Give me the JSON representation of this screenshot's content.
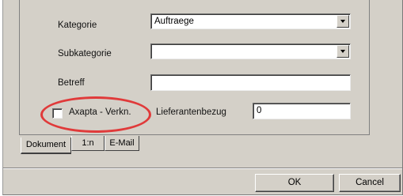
{
  "form": {
    "kategorie": {
      "label": "Kategorie",
      "value": "Auftraege"
    },
    "subkategorie": {
      "label": "Subkategorie",
      "value": ""
    },
    "betreff": {
      "label": "Betreff",
      "value": ""
    },
    "axapta_checkbox": {
      "label": "Axapta - Verkn.",
      "checked": false
    },
    "lieferantenbezug": {
      "label": "Lieferantenbezug",
      "value": "0"
    }
  },
  "tabs": [
    {
      "label": "Dokument",
      "active": true
    },
    {
      "label": "1:n",
      "active": false
    },
    {
      "label": "E-Mail",
      "active": false
    }
  ],
  "buttons": {
    "ok_label": "OK",
    "cancel_label": "Cancel"
  },
  "highlight_color": "#e03a3a"
}
